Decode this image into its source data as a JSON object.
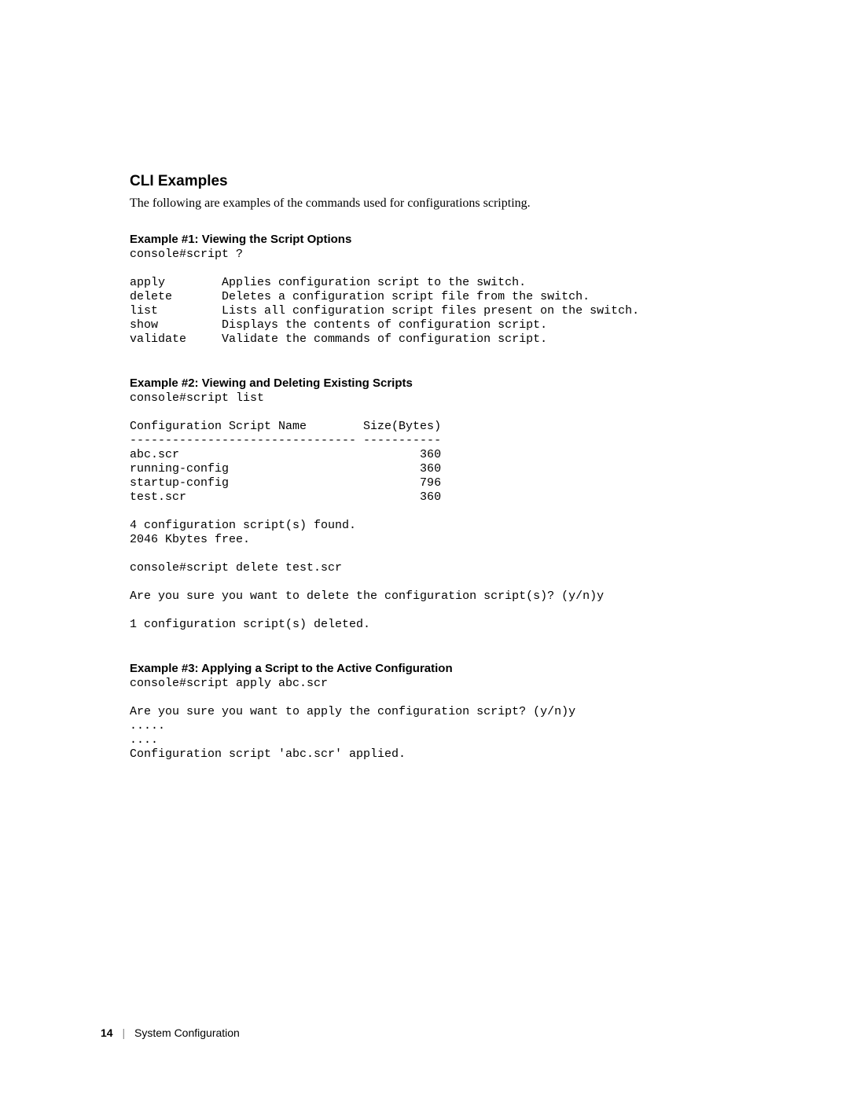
{
  "heading": "CLI Examples",
  "intro": "The following are examples of the commands used for configurations scripting.",
  "example1": {
    "title": "Example #1: Viewing the Script Options",
    "code": "console#script ?\n\napply        Applies configuration script to the switch.\ndelete       Deletes a configuration script file from the switch.\nlist         Lists all configuration script files present on the switch.\nshow         Displays the contents of configuration script.\nvalidate     Validate the commands of configuration script."
  },
  "example2": {
    "title": "Example #2: Viewing and Deleting Existing Scripts",
    "code": "console#script list\n\nConfiguration Script Name        Size(Bytes)\n-------------------------------- -----------\nabc.scr                                  360\nrunning-config                           360\nstartup-config                           796\ntest.scr                                 360\n\n4 configuration script(s) found.\n2046 Kbytes free.\n\nconsole#script delete test.scr\n\nAre you sure you want to delete the configuration script(s)? (y/n)y\n\n1 configuration script(s) deleted."
  },
  "example3": {
    "title": "Example #3: Applying a Script to the Active Configuration",
    "code": "console#script apply abc.scr\n\nAre you sure you want to apply the configuration script? (y/n)y\n.....\n....\nConfiguration script 'abc.scr' applied."
  },
  "footer": {
    "page_number": "14",
    "divider": "|",
    "chapter": "System Configuration"
  }
}
